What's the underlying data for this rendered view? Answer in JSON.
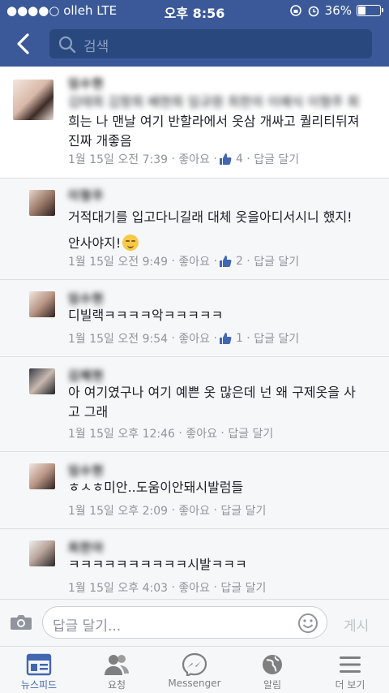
{
  "status": {
    "carrier": "●●●●○ olleh  LTE",
    "time": "오후 8:56",
    "battery": "36%"
  },
  "nav": {
    "search_placeholder": "검색"
  },
  "comments": [
    {
      "name": "임수현",
      "blurred_text": "김태희 김항희 배현희 임규원 최한의 이예식 이형주 회",
      "text": "희는 나 맨날 여기 반할라에서 옷삼 개싸고 퀄리티뒤져\n진짜 개좋음",
      "time": "1월 15일 오전 7:39",
      "like": "좋아요",
      "likes": "4",
      "reply": "답글 달기"
    },
    {
      "name": "이형주",
      "text": "거적대기를 입고다니길래 대체 옷을아디서시니 했지!\n안사야지!",
      "time": "1월 15일 오전 9:49",
      "like": "좋아요",
      "likes": "2",
      "reply": "답글 달기"
    },
    {
      "name": "임수현",
      "text": "디빌랙ㅋㅋㅋㅋ악ㅋㅋㅋㅋㅋ",
      "time": "1월 15일 오전 9:54",
      "like": "좋아요",
      "likes": "1",
      "reply": "답글 달기"
    },
    {
      "name": "김혜현",
      "text": "아 여기였구나 여기 예쁜 옷 많은데 넌 왜 구제옷을 사\n고 그래",
      "time": "1월 15일 오후 12:46",
      "like": "좋아요",
      "reply": "답글 달기"
    },
    {
      "name": "임수현",
      "text": "ㅎㅅㅎ미안..도움이안돼시발럼들",
      "time": "1월 15일 오후 2:09",
      "like": "좋아요",
      "reply": "답글 달기"
    },
    {
      "name": "최한아",
      "text": "ㅋㅋㅋㅋㅋㅋㅋㅋㅋㅋ시발ㅋㅋㅋ",
      "time": "1월 15일 오후 4:03",
      "like": "좋아요",
      "reply": "답글 달기"
    }
  ],
  "composer": {
    "placeholder": "답글 달기...",
    "post": "게시"
  },
  "tabs": [
    {
      "label": "뉴스피드",
      "icon": "news-feed-icon",
      "active": true
    },
    {
      "label": "요청",
      "icon": "friend-requests-icon"
    },
    {
      "label": "Messenger",
      "icon": "messenger-icon"
    },
    {
      "label": "알림",
      "icon": "globe-icon"
    },
    {
      "label": "더 보기",
      "icon": "menu-icon"
    }
  ],
  "colors": {
    "brand": "#3b5998",
    "meta": "#90949c",
    "active_tab": "#4267b2"
  }
}
